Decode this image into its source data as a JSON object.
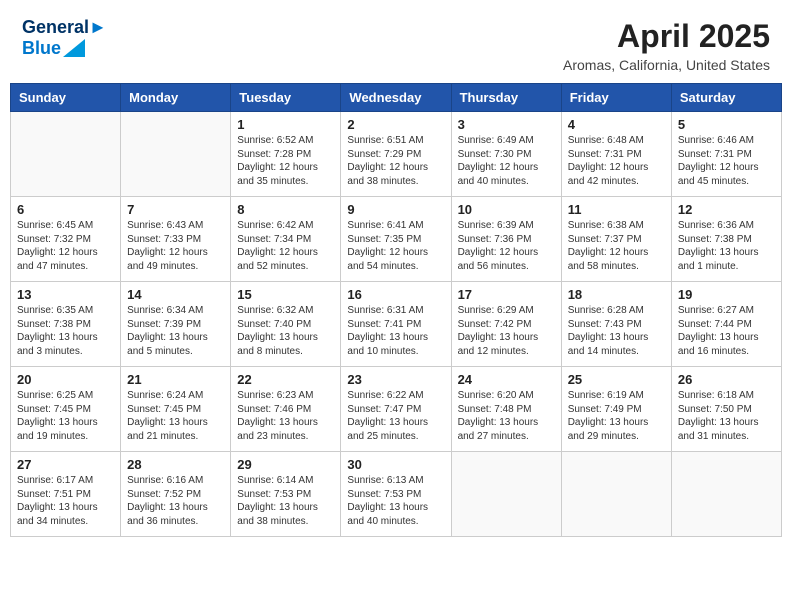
{
  "header": {
    "logo_line1": "General",
    "logo_line2": "Blue",
    "month_title": "April 2025",
    "location": "Aromas, California, United States"
  },
  "days_of_week": [
    "Sunday",
    "Monday",
    "Tuesday",
    "Wednesday",
    "Thursday",
    "Friday",
    "Saturday"
  ],
  "weeks": [
    [
      {
        "day": "",
        "info": ""
      },
      {
        "day": "",
        "info": ""
      },
      {
        "day": "1",
        "info": "Sunrise: 6:52 AM\nSunset: 7:28 PM\nDaylight: 12 hours and 35 minutes."
      },
      {
        "day": "2",
        "info": "Sunrise: 6:51 AM\nSunset: 7:29 PM\nDaylight: 12 hours and 38 minutes."
      },
      {
        "day": "3",
        "info": "Sunrise: 6:49 AM\nSunset: 7:30 PM\nDaylight: 12 hours and 40 minutes."
      },
      {
        "day": "4",
        "info": "Sunrise: 6:48 AM\nSunset: 7:31 PM\nDaylight: 12 hours and 42 minutes."
      },
      {
        "day": "5",
        "info": "Sunrise: 6:46 AM\nSunset: 7:31 PM\nDaylight: 12 hours and 45 minutes."
      }
    ],
    [
      {
        "day": "6",
        "info": "Sunrise: 6:45 AM\nSunset: 7:32 PM\nDaylight: 12 hours and 47 minutes."
      },
      {
        "day": "7",
        "info": "Sunrise: 6:43 AM\nSunset: 7:33 PM\nDaylight: 12 hours and 49 minutes."
      },
      {
        "day": "8",
        "info": "Sunrise: 6:42 AM\nSunset: 7:34 PM\nDaylight: 12 hours and 52 minutes."
      },
      {
        "day": "9",
        "info": "Sunrise: 6:41 AM\nSunset: 7:35 PM\nDaylight: 12 hours and 54 minutes."
      },
      {
        "day": "10",
        "info": "Sunrise: 6:39 AM\nSunset: 7:36 PM\nDaylight: 12 hours and 56 minutes."
      },
      {
        "day": "11",
        "info": "Sunrise: 6:38 AM\nSunset: 7:37 PM\nDaylight: 12 hours and 58 minutes."
      },
      {
        "day": "12",
        "info": "Sunrise: 6:36 AM\nSunset: 7:38 PM\nDaylight: 13 hours and 1 minute."
      }
    ],
    [
      {
        "day": "13",
        "info": "Sunrise: 6:35 AM\nSunset: 7:38 PM\nDaylight: 13 hours and 3 minutes."
      },
      {
        "day": "14",
        "info": "Sunrise: 6:34 AM\nSunset: 7:39 PM\nDaylight: 13 hours and 5 minutes."
      },
      {
        "day": "15",
        "info": "Sunrise: 6:32 AM\nSunset: 7:40 PM\nDaylight: 13 hours and 8 minutes."
      },
      {
        "day": "16",
        "info": "Sunrise: 6:31 AM\nSunset: 7:41 PM\nDaylight: 13 hours and 10 minutes."
      },
      {
        "day": "17",
        "info": "Sunrise: 6:29 AM\nSunset: 7:42 PM\nDaylight: 13 hours and 12 minutes."
      },
      {
        "day": "18",
        "info": "Sunrise: 6:28 AM\nSunset: 7:43 PM\nDaylight: 13 hours and 14 minutes."
      },
      {
        "day": "19",
        "info": "Sunrise: 6:27 AM\nSunset: 7:44 PM\nDaylight: 13 hours and 16 minutes."
      }
    ],
    [
      {
        "day": "20",
        "info": "Sunrise: 6:25 AM\nSunset: 7:45 PM\nDaylight: 13 hours and 19 minutes."
      },
      {
        "day": "21",
        "info": "Sunrise: 6:24 AM\nSunset: 7:45 PM\nDaylight: 13 hours and 21 minutes."
      },
      {
        "day": "22",
        "info": "Sunrise: 6:23 AM\nSunset: 7:46 PM\nDaylight: 13 hours and 23 minutes."
      },
      {
        "day": "23",
        "info": "Sunrise: 6:22 AM\nSunset: 7:47 PM\nDaylight: 13 hours and 25 minutes."
      },
      {
        "day": "24",
        "info": "Sunrise: 6:20 AM\nSunset: 7:48 PM\nDaylight: 13 hours and 27 minutes."
      },
      {
        "day": "25",
        "info": "Sunrise: 6:19 AM\nSunset: 7:49 PM\nDaylight: 13 hours and 29 minutes."
      },
      {
        "day": "26",
        "info": "Sunrise: 6:18 AM\nSunset: 7:50 PM\nDaylight: 13 hours and 31 minutes."
      }
    ],
    [
      {
        "day": "27",
        "info": "Sunrise: 6:17 AM\nSunset: 7:51 PM\nDaylight: 13 hours and 34 minutes."
      },
      {
        "day": "28",
        "info": "Sunrise: 6:16 AM\nSunset: 7:52 PM\nDaylight: 13 hours and 36 minutes."
      },
      {
        "day": "29",
        "info": "Sunrise: 6:14 AM\nSunset: 7:53 PM\nDaylight: 13 hours and 38 minutes."
      },
      {
        "day": "30",
        "info": "Sunrise: 6:13 AM\nSunset: 7:53 PM\nDaylight: 13 hours and 40 minutes."
      },
      {
        "day": "",
        "info": ""
      },
      {
        "day": "",
        "info": ""
      },
      {
        "day": "",
        "info": ""
      }
    ]
  ]
}
